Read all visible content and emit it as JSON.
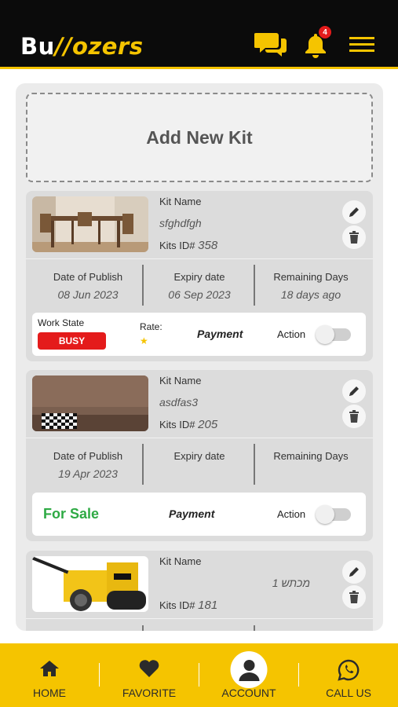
{
  "app": {
    "logo_part1": "Bu",
    "logo_part2": "//",
    "logo_part3": "ozers",
    "notification_count": "4"
  },
  "add_kit": {
    "label": "Add New Kit"
  },
  "labels": {
    "kit_name": "Kit Name",
    "kits_id": "Kits ID#",
    "date_of_publish": "Date of Publish",
    "expiry_date": "Expiry date",
    "remaining_days": "Remaining Days",
    "work_state": "Work State",
    "rate": "Rate:",
    "payment": "Payment",
    "action": "Action"
  },
  "kits": [
    {
      "name": "sfghdfgh",
      "id": "358",
      "date_of_publish": "08 Jun 2023",
      "expiry_date": "06 Sep 2023",
      "remaining": "18 days ago",
      "work_state": "BUSY",
      "rating": 1,
      "action_on": false
    },
    {
      "name": "asdfas3",
      "id": "205",
      "date_of_publish": "19 Apr 2023",
      "expiry_date": "",
      "remaining": "",
      "status": "For Sale",
      "action_on": false
    },
    {
      "name": "מכתש 1",
      "id": "181"
    }
  ],
  "nav": [
    {
      "label": "HOME",
      "icon": "home-icon"
    },
    {
      "label": "FAVORITE",
      "icon": "heart-icon"
    },
    {
      "label": "ACCOUNT",
      "icon": "user-icon"
    },
    {
      "label": "CALL US",
      "icon": "whatsapp-icon"
    }
  ],
  "colors": {
    "brand_yellow": "#f5c400",
    "header_black": "#0b0b0b",
    "busy_red": "#e41b1b",
    "sale_green": "#2eaa44"
  }
}
